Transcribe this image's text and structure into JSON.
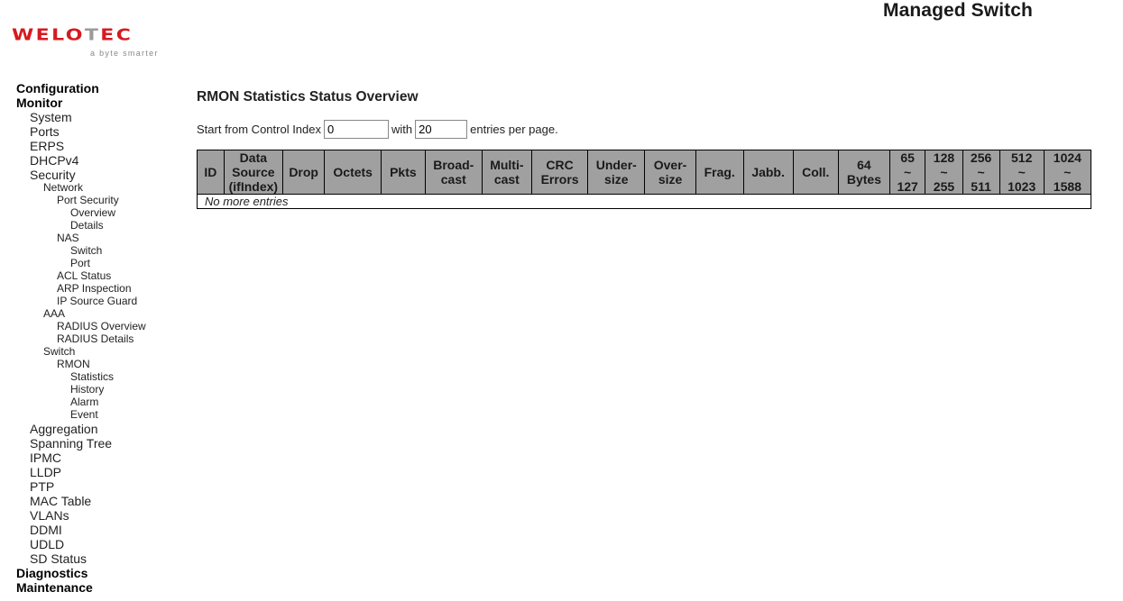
{
  "header": {
    "app_title": "Managed Switch",
    "logo": {
      "brand_prefix": "WELO",
      "brand_t": "T",
      "brand_suffix": "EC",
      "tagline": "a byte smarter",
      "brand_color": "#d71920"
    }
  },
  "menu": [
    {
      "label": "Configuration",
      "level": 0
    },
    {
      "label": "Monitor",
      "level": 0
    },
    {
      "label": "System",
      "level": 1
    },
    {
      "label": "Ports",
      "level": 1
    },
    {
      "label": "ERPS",
      "level": 1
    },
    {
      "label": "DHCPv4",
      "level": 1
    },
    {
      "label": "Security",
      "level": 1
    },
    {
      "label": "Network",
      "level": 2
    },
    {
      "label": "Port Security",
      "level": 3
    },
    {
      "label": "Overview",
      "level": 4
    },
    {
      "label": "Details",
      "level": 4
    },
    {
      "label": "NAS",
      "level": 3
    },
    {
      "label": "Switch",
      "level": 4
    },
    {
      "label": "Port",
      "level": 4
    },
    {
      "label": "ACL Status",
      "level": 3
    },
    {
      "label": "ARP Inspection",
      "level": 3
    },
    {
      "label": "IP Source Guard",
      "level": 3
    },
    {
      "label": "AAA",
      "level": 2
    },
    {
      "label": "RADIUS Overview",
      "level": 3
    },
    {
      "label": "RADIUS Details",
      "level": 3
    },
    {
      "label": "Switch",
      "level": 2
    },
    {
      "label": "RMON",
      "level": 3
    },
    {
      "label": "Statistics",
      "level": 4
    },
    {
      "label": "History",
      "level": 4
    },
    {
      "label": "Alarm",
      "level": 4
    },
    {
      "label": "Event",
      "level": 4
    },
    {
      "label": "Aggregation",
      "level": 1
    },
    {
      "label": "Spanning Tree",
      "level": 1
    },
    {
      "label": "IPMC",
      "level": 1
    },
    {
      "label": "LLDP",
      "level": 1
    },
    {
      "label": "PTP",
      "level": 1
    },
    {
      "label": "MAC Table",
      "level": 1
    },
    {
      "label": "VLANs",
      "level": 1
    },
    {
      "label": "DDMI",
      "level": 1
    },
    {
      "label": "UDLD",
      "level": 1
    },
    {
      "label": "SD Status",
      "level": 1
    },
    {
      "label": "Diagnostics",
      "level": 0
    },
    {
      "label": "Maintenance",
      "level": 0
    }
  ],
  "main": {
    "title": "RMON Statistics Status Overview",
    "paging": {
      "prefix": "Start from Control Index",
      "start_index": "0",
      "middle": "with",
      "entries_per_page": "20",
      "suffix": "entries per page."
    },
    "table": {
      "columns": [
        [
          "ID"
        ],
        [
          "Data",
          "Source",
          "(ifIndex)"
        ],
        [
          "Drop"
        ],
        [
          "Octets"
        ],
        [
          "Pkts"
        ],
        [
          "Broad-",
          "cast"
        ],
        [
          "Multi-",
          "cast"
        ],
        [
          "CRC",
          "Errors"
        ],
        [
          "Under-",
          "size"
        ],
        [
          "Over-",
          "size"
        ],
        [
          "Frag."
        ],
        [
          "Jabb."
        ],
        [
          "Coll."
        ],
        [
          "64",
          "Bytes"
        ],
        [
          "65",
          "~",
          "127"
        ],
        [
          "128",
          "~",
          "255"
        ],
        [
          "256",
          "~",
          "511"
        ],
        [
          "512",
          "~",
          "1023"
        ],
        [
          "1024",
          "~",
          "1588"
        ]
      ],
      "empty_message": "No more entries"
    }
  }
}
